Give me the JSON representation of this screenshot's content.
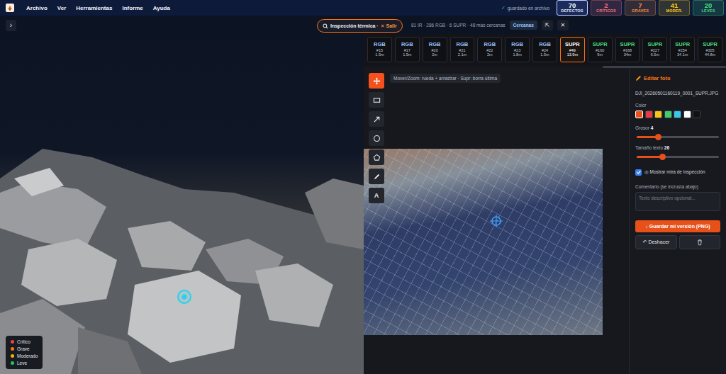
{
  "app": {
    "menu": [
      "Archivo",
      "Ver",
      "Herramientas",
      "Informe",
      "Ayuda"
    ],
    "saved_icon": "✓",
    "saved": "guardado en archivo"
  },
  "stats": [
    {
      "value": "70",
      "label": "DEFECTOS",
      "color": "#e5e7eb",
      "selected": true
    },
    {
      "value": "2",
      "label": "CRÍTICOS",
      "color": "#f87171",
      "selected": false
    },
    {
      "value": "7",
      "label": "GRAVES",
      "color": "#fb923c",
      "selected": false
    },
    {
      "value": "41",
      "label": "MODER.",
      "color": "#facc15",
      "selected": false
    },
    {
      "value": "20",
      "label": "LEVES",
      "color": "#4ade80",
      "selected": false
    }
  ],
  "viewer": {
    "toggle": "›",
    "legend": [
      {
        "label": "Crítico",
        "color": "#ef4444"
      },
      {
        "label": "Grave",
        "color": "#f97316"
      },
      {
        "label": "Moderado",
        "color": "#eab308"
      },
      {
        "label": "Leve",
        "color": "#22c55e"
      }
    ]
  },
  "inspection": {
    "title": "Inspección térmica ·",
    "exit": "✕ Salir",
    "summary": "81 IR · 286 RGB · 6 SUPR · 48 más cercanas",
    "nearby": "Cercanas",
    "collapse": "⇱",
    "close": "✕"
  },
  "thumbnails": [
    {
      "kind": "RGB",
      "number": "#15",
      "distance": "1.5m",
      "selected": false
    },
    {
      "kind": "RGB",
      "number": "#17",
      "distance": "1.5m",
      "selected": false
    },
    {
      "kind": "RGB",
      "number": "#20",
      "distance": "2m",
      "selected": false
    },
    {
      "kind": "RGB",
      "number": "#21",
      "distance": "2.1m",
      "selected": false
    },
    {
      "kind": "RGB",
      "number": "#22",
      "distance": "2m",
      "selected": false
    },
    {
      "kind": "RGB",
      "number": "#23",
      "distance": "1.8m",
      "selected": false
    },
    {
      "kind": "RGB",
      "number": "#24",
      "distance": "1.5m",
      "selected": false
    },
    {
      "kind": "SUPR",
      "number": "#49",
      "distance": "13.9m",
      "selected": true
    },
    {
      "kind": "SUPR",
      "number": "#160",
      "distance": "9m",
      "selected": false
    },
    {
      "kind": "SUPR",
      "number": "#168",
      "distance": "34m",
      "selected": false
    },
    {
      "kind": "SUPR",
      "number": "#227",
      "distance": "6.5m",
      "selected": false
    },
    {
      "kind": "SUPR",
      "number": "#254",
      "distance": "34.1m",
      "selected": false
    },
    {
      "kind": "SUPR",
      "number": "#305",
      "distance": "44.8m",
      "selected": false
    }
  ],
  "editor": {
    "tools": [
      {
        "kind": "move",
        "selected": true
      },
      {
        "kind": "rect",
        "selected": false
      },
      {
        "kind": "arrow",
        "selected": false
      },
      {
        "kind": "circle",
        "selected": false
      },
      {
        "kind": "polygon",
        "selected": false
      },
      {
        "kind": "pen",
        "selected": false
      },
      {
        "kind": "text",
        "label": "A",
        "selected": false
      }
    ],
    "hint": "Mover/Zoom: rueda + arrastrar · Supr: borra última"
  },
  "side": {
    "title": "Editar foto",
    "filename": "DJI_20260501160119_0001_SUPR.JPG",
    "color_label": "Color",
    "swatches": [
      {
        "color": "#e8501a",
        "selected": true
      },
      {
        "color": "#e53946",
        "selected": false
      },
      {
        "color": "#f5c518",
        "selected": false
      },
      {
        "color": "#3ecf6b",
        "selected": false
      },
      {
        "color": "#38c8e8",
        "selected": false
      },
      {
        "color": "#ffffff",
        "selected": false
      },
      {
        "color": "#111111",
        "selected": false
      }
    ],
    "sliders": [
      {
        "label": "Grosor",
        "value": "4",
        "level": 0.26
      },
      {
        "label": "Tamaño texto",
        "value": "26",
        "level": 0.31
      }
    ],
    "crosshair": {
      "label": "◎ Mostrar mira de inspección",
      "checked": true
    },
    "comment": {
      "label": "Comentario (se incrusta abajo)",
      "placeholder": "Texto descriptivo opcional..."
    },
    "save": "↓ Guardar mi versión (PNG)",
    "undo": "↶ Deshacer"
  }
}
